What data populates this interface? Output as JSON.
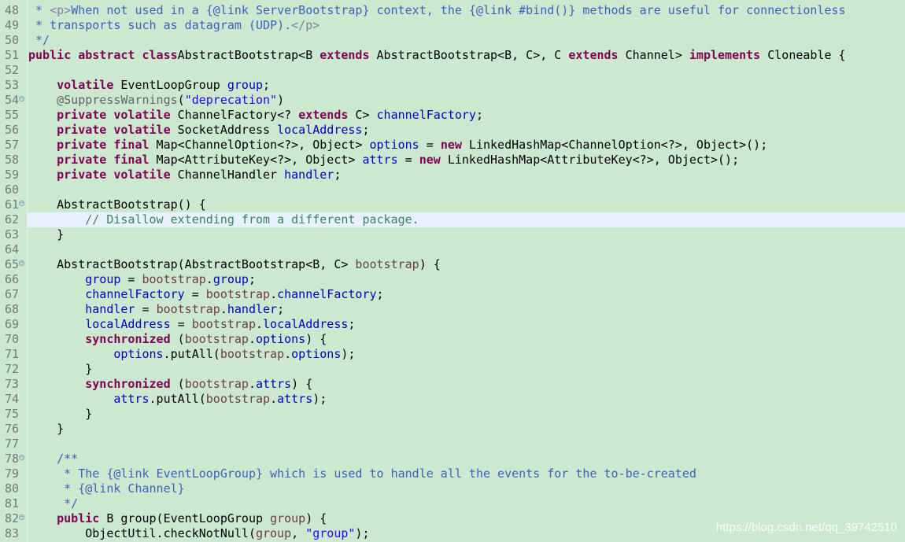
{
  "editor": {
    "watermark": "https://blog.csdn.net/qq_39742510",
    "colors": {
      "background": "#cce8cf",
      "current_line": "#e8f2fe",
      "keyword": "#7f0055",
      "field": "#0000c0",
      "string": "#2a00ff",
      "javadoc": "#3f5fbf",
      "comment": "#3f7f5f"
    },
    "lines": [
      {
        "n": "48",
        "segs": [
          [
            "jd",
            " * "
          ],
          [
            "jdt",
            "<p>"
          ],
          [
            "jd",
            "When not used in a {@link ServerBootstrap} context, the {@link #bind()} methods are useful for connectionless"
          ]
        ]
      },
      {
        "n": "49",
        "segs": [
          [
            "jd",
            " * transports such as datagram (UDP)."
          ],
          [
            "jdt",
            "</p>"
          ]
        ]
      },
      {
        "n": "50",
        "segs": [
          [
            "jd",
            " */"
          ]
        ]
      },
      {
        "n": "51",
        "segs": [
          [
            "kw",
            "public abstract class"
          ],
          [
            "",
            "AbstractBootstrap<B "
          ],
          [
            "kw",
            "extends"
          ],
          [
            "",
            " AbstractBootstrap<B, C>, C "
          ],
          [
            "kw",
            "extends"
          ],
          [
            "",
            " Channel> "
          ],
          [
            "kw",
            "implements"
          ],
          [
            "",
            " Cloneable {"
          ]
        ]
      },
      {
        "n": "52",
        "segs": []
      },
      {
        "n": "53",
        "segs": [
          [
            "",
            "    "
          ],
          [
            "kw",
            "volatile"
          ],
          [
            "",
            " EventLoopGroup "
          ],
          [
            "fld",
            "group"
          ],
          [
            "",
            ";"
          ]
        ]
      },
      {
        "n": "54",
        "fold": true,
        "segs": [
          [
            "",
            "    "
          ],
          [
            "ann",
            "@SuppressWarnings"
          ],
          [
            "",
            "("
          ],
          [
            "str",
            "\"deprecation\""
          ],
          [
            "",
            ")"
          ]
        ]
      },
      {
        "n": "55",
        "segs": [
          [
            "",
            "    "
          ],
          [
            "kw",
            "private volatile"
          ],
          [
            "",
            " ChannelFactory<? "
          ],
          [
            "kw",
            "extends"
          ],
          [
            "",
            " C> "
          ],
          [
            "fld",
            "channelFactory"
          ],
          [
            "",
            ";"
          ]
        ]
      },
      {
        "n": "56",
        "segs": [
          [
            "",
            "    "
          ],
          [
            "kw",
            "private volatile"
          ],
          [
            "",
            " SocketAddress "
          ],
          [
            "fld",
            "localAddress"
          ],
          [
            "",
            ";"
          ]
        ]
      },
      {
        "n": "57",
        "segs": [
          [
            "",
            "    "
          ],
          [
            "kw",
            "private final"
          ],
          [
            "",
            " Map<ChannelOption<?>, Object> "
          ],
          [
            "fld",
            "options"
          ],
          [
            "",
            " = "
          ],
          [
            "kw",
            "new"
          ],
          [
            "",
            " LinkedHashMap<ChannelOption<?>, Object>();"
          ]
        ]
      },
      {
        "n": "58",
        "segs": [
          [
            "",
            "    "
          ],
          [
            "kw",
            "private final"
          ],
          [
            "",
            " Map<AttributeKey<?>, Object> "
          ],
          [
            "fld",
            "attrs"
          ],
          [
            "",
            " = "
          ],
          [
            "kw",
            "new"
          ],
          [
            "",
            " LinkedHashMap<AttributeKey<?>, Object>();"
          ]
        ]
      },
      {
        "n": "59",
        "segs": [
          [
            "",
            "    "
          ],
          [
            "kw",
            "private volatile"
          ],
          [
            "",
            " ChannelHandler "
          ],
          [
            "fld",
            "handler"
          ],
          [
            "",
            ";"
          ]
        ]
      },
      {
        "n": "60",
        "segs": []
      },
      {
        "n": "61",
        "fold": true,
        "segs": [
          [
            "",
            "    AbstractBootstrap() {"
          ]
        ]
      },
      {
        "n": "62",
        "current": true,
        "segs": [
          [
            "",
            "        "
          ],
          [
            "cm",
            "// Disallow extending from a different package."
          ]
        ]
      },
      {
        "n": "63",
        "segs": [
          [
            "",
            "    }"
          ]
        ]
      },
      {
        "n": "64",
        "segs": []
      },
      {
        "n": "65",
        "fold": true,
        "segs": [
          [
            "",
            "    AbstractBootstrap(AbstractBootstrap<B, C> "
          ],
          [
            "prm",
            "bootstrap"
          ],
          [
            "",
            ") {"
          ]
        ]
      },
      {
        "n": "66",
        "segs": [
          [
            "",
            "        "
          ],
          [
            "fld",
            "group"
          ],
          [
            "",
            " = "
          ],
          [
            "prm",
            "bootstrap"
          ],
          [
            "",
            "."
          ],
          [
            "fld",
            "group"
          ],
          [
            "",
            ";"
          ]
        ]
      },
      {
        "n": "67",
        "segs": [
          [
            "",
            "        "
          ],
          [
            "fld",
            "channelFactory"
          ],
          [
            "",
            " = "
          ],
          [
            "prm",
            "bootstrap"
          ],
          [
            "",
            "."
          ],
          [
            "fld",
            "channelFactory"
          ],
          [
            "",
            ";"
          ]
        ]
      },
      {
        "n": "68",
        "segs": [
          [
            "",
            "        "
          ],
          [
            "fld",
            "handler"
          ],
          [
            "",
            " = "
          ],
          [
            "prm",
            "bootstrap"
          ],
          [
            "",
            "."
          ],
          [
            "fld",
            "handler"
          ],
          [
            "",
            ";"
          ]
        ]
      },
      {
        "n": "69",
        "segs": [
          [
            "",
            "        "
          ],
          [
            "fld",
            "localAddress"
          ],
          [
            "",
            " = "
          ],
          [
            "prm",
            "bootstrap"
          ],
          [
            "",
            "."
          ],
          [
            "fld",
            "localAddress"
          ],
          [
            "",
            ";"
          ]
        ]
      },
      {
        "n": "70",
        "segs": [
          [
            "",
            "        "
          ],
          [
            "kw",
            "synchronized"
          ],
          [
            "",
            " ("
          ],
          [
            "prm",
            "bootstrap"
          ],
          [
            "",
            "."
          ],
          [
            "fld",
            "options"
          ],
          [
            "",
            ") {"
          ]
        ]
      },
      {
        "n": "71",
        "segs": [
          [
            "",
            "            "
          ],
          [
            "fld",
            "options"
          ],
          [
            "",
            ".putAll("
          ],
          [
            "prm",
            "bootstrap"
          ],
          [
            "",
            "."
          ],
          [
            "fld",
            "options"
          ],
          [
            "",
            ");"
          ]
        ]
      },
      {
        "n": "72",
        "segs": [
          [
            "",
            "        }"
          ]
        ]
      },
      {
        "n": "73",
        "segs": [
          [
            "",
            "        "
          ],
          [
            "kw",
            "synchronized"
          ],
          [
            "",
            " ("
          ],
          [
            "prm",
            "bootstrap"
          ],
          [
            "",
            "."
          ],
          [
            "fld",
            "attrs"
          ],
          [
            "",
            ") {"
          ]
        ]
      },
      {
        "n": "74",
        "segs": [
          [
            "",
            "            "
          ],
          [
            "fld",
            "attrs"
          ],
          [
            "",
            ".putAll("
          ],
          [
            "prm",
            "bootstrap"
          ],
          [
            "",
            "."
          ],
          [
            "fld",
            "attrs"
          ],
          [
            "",
            ");"
          ]
        ]
      },
      {
        "n": "75",
        "segs": [
          [
            "",
            "        }"
          ]
        ]
      },
      {
        "n": "76",
        "segs": [
          [
            "",
            "    }"
          ]
        ]
      },
      {
        "n": "77",
        "segs": []
      },
      {
        "n": "78",
        "fold": true,
        "segs": [
          [
            "",
            "    "
          ],
          [
            "jd",
            "/**"
          ]
        ]
      },
      {
        "n": "79",
        "segs": [
          [
            "",
            "     "
          ],
          [
            "jd",
            "* The {@link EventLoopGroup} which is used to handle all the events for the to-be-created"
          ]
        ]
      },
      {
        "n": "80",
        "segs": [
          [
            "",
            "     "
          ],
          [
            "jd",
            "* {@link Channel}"
          ]
        ]
      },
      {
        "n": "81",
        "segs": [
          [
            "",
            "     "
          ],
          [
            "jd",
            "*/"
          ]
        ]
      },
      {
        "n": "82",
        "fold": true,
        "segs": [
          [
            "",
            "    "
          ],
          [
            "kw",
            "public"
          ],
          [
            "",
            " B group(EventLoopGroup "
          ],
          [
            "prm",
            "group"
          ],
          [
            "",
            ") {"
          ]
        ]
      },
      {
        "n": "83",
        "segs": [
          [
            "",
            "        ObjectUtil.checkNotNull("
          ],
          [
            "prm",
            "group"
          ],
          [
            "",
            ", "
          ],
          [
            "str",
            "\"group\""
          ],
          [
            "",
            ");"
          ]
        ]
      }
    ]
  }
}
